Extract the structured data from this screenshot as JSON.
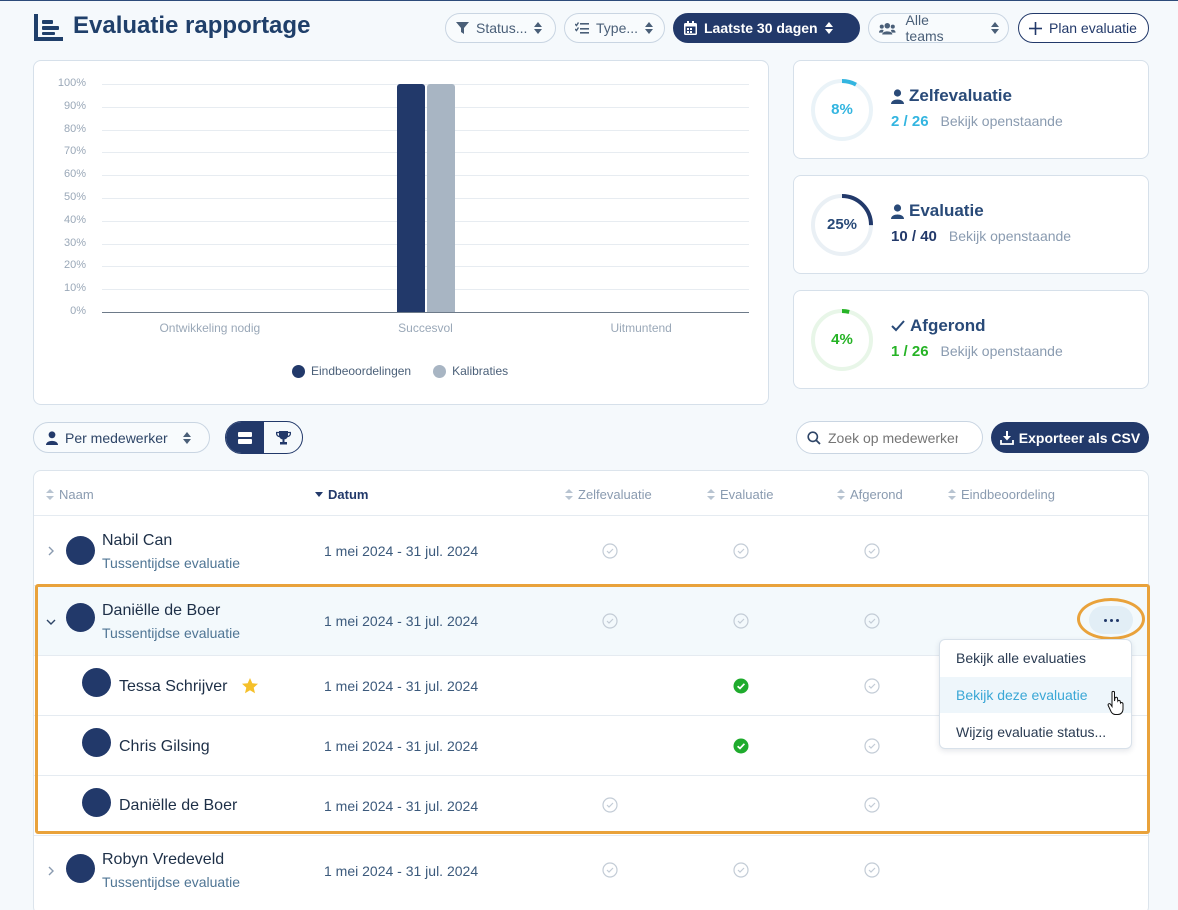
{
  "header": {
    "title": "Evaluatie rapportage",
    "filters": {
      "status": "Status...",
      "type": "Type...",
      "period": "Laatste 30 dagen",
      "teams": "Alle teams",
      "plan": "Plan evaluatie"
    }
  },
  "chart_data": {
    "type": "bar",
    "categories": [
      "Ontwikkeling nodig",
      "Succesvol",
      "Uitmuntend"
    ],
    "series": [
      {
        "name": "Eindbeoordelingen",
        "values": [
          0,
          100,
          0
        ],
        "color": "#22396a"
      },
      {
        "name": "Kalibraties",
        "values": [
          0,
          100,
          0
        ],
        "color": "#a8b5c3"
      }
    ],
    "yticks": [
      "0%",
      "10%",
      "20%",
      "30%",
      "40%",
      "50%",
      "60%",
      "70%",
      "80%",
      "90%",
      "100%"
    ],
    "ylim": [
      0,
      100
    ],
    "grid": true,
    "legend_position": "bottom"
  },
  "stats": [
    {
      "title": "Zelfevaluatie",
      "percent": "8%",
      "fraction": 0.08,
      "done": "2",
      "sep": "/",
      "total": "26",
      "link": "Bekijk openstaande",
      "color": "#33b5e0",
      "num_color": "#33b5e0",
      "icon": "person-icon"
    },
    {
      "title": "Evaluatie",
      "percent": "25%",
      "fraction": 0.25,
      "done": "10",
      "sep": "/",
      "total": "40",
      "link": "Bekijk openstaande",
      "color": "#22396a",
      "num_color": "#22396a",
      "icon": "person-icon"
    },
    {
      "title": "Afgerond",
      "percent": "4%",
      "fraction": 0.04,
      "done": "1",
      "sep": "/",
      "total": "26",
      "link": "Bekijk openstaande",
      "color": "#26b326",
      "num_color": "#26b326",
      "icon": "check-icon"
    }
  ],
  "toolbar": {
    "groupby": "Per medewerker",
    "search_placeholder": "Zoek op medewerker",
    "export": "Exporteer als CSV"
  },
  "table": {
    "columns": [
      "Naam",
      "Datum",
      "Zelfevaluatie",
      "Evaluatie",
      "Afgerond",
      "Eindbeoordeling"
    ],
    "rows": [
      {
        "name": "Nabil Can",
        "sub": "Tussentijdse evaluatie",
        "date": "1 mei 2024 - 31 jul. 2024"
      },
      {
        "name": "Daniëlle de Boer",
        "sub": "Tussentijdse evaluatie",
        "date": "1 mei 2024 - 31 jul. 2024"
      },
      {
        "name": "Tessa Schrijver",
        "date": "1 mei 2024 - 31 jul. 2024"
      },
      {
        "name": "Chris Gilsing",
        "date": "1 mei 2024 - 31 jul. 2024"
      },
      {
        "name": "Daniëlle de Boer",
        "date": "1 mei 2024 - 31 jul. 2024"
      },
      {
        "name": "Robyn Vredeveld",
        "sub": "Tussentijdse evaluatie",
        "date": "1 mei 2024 - 31 jul. 2024"
      }
    ]
  },
  "menu": {
    "items": [
      "Bekijk alle evaluaties",
      "Bekijk deze evaluatie",
      "Wijzig evaluatie status..."
    ]
  },
  "colors": {
    "primary": "#22396a",
    "highlight": "#e9a23b",
    "success": "#26b326",
    "accent": "#33b5e0"
  }
}
